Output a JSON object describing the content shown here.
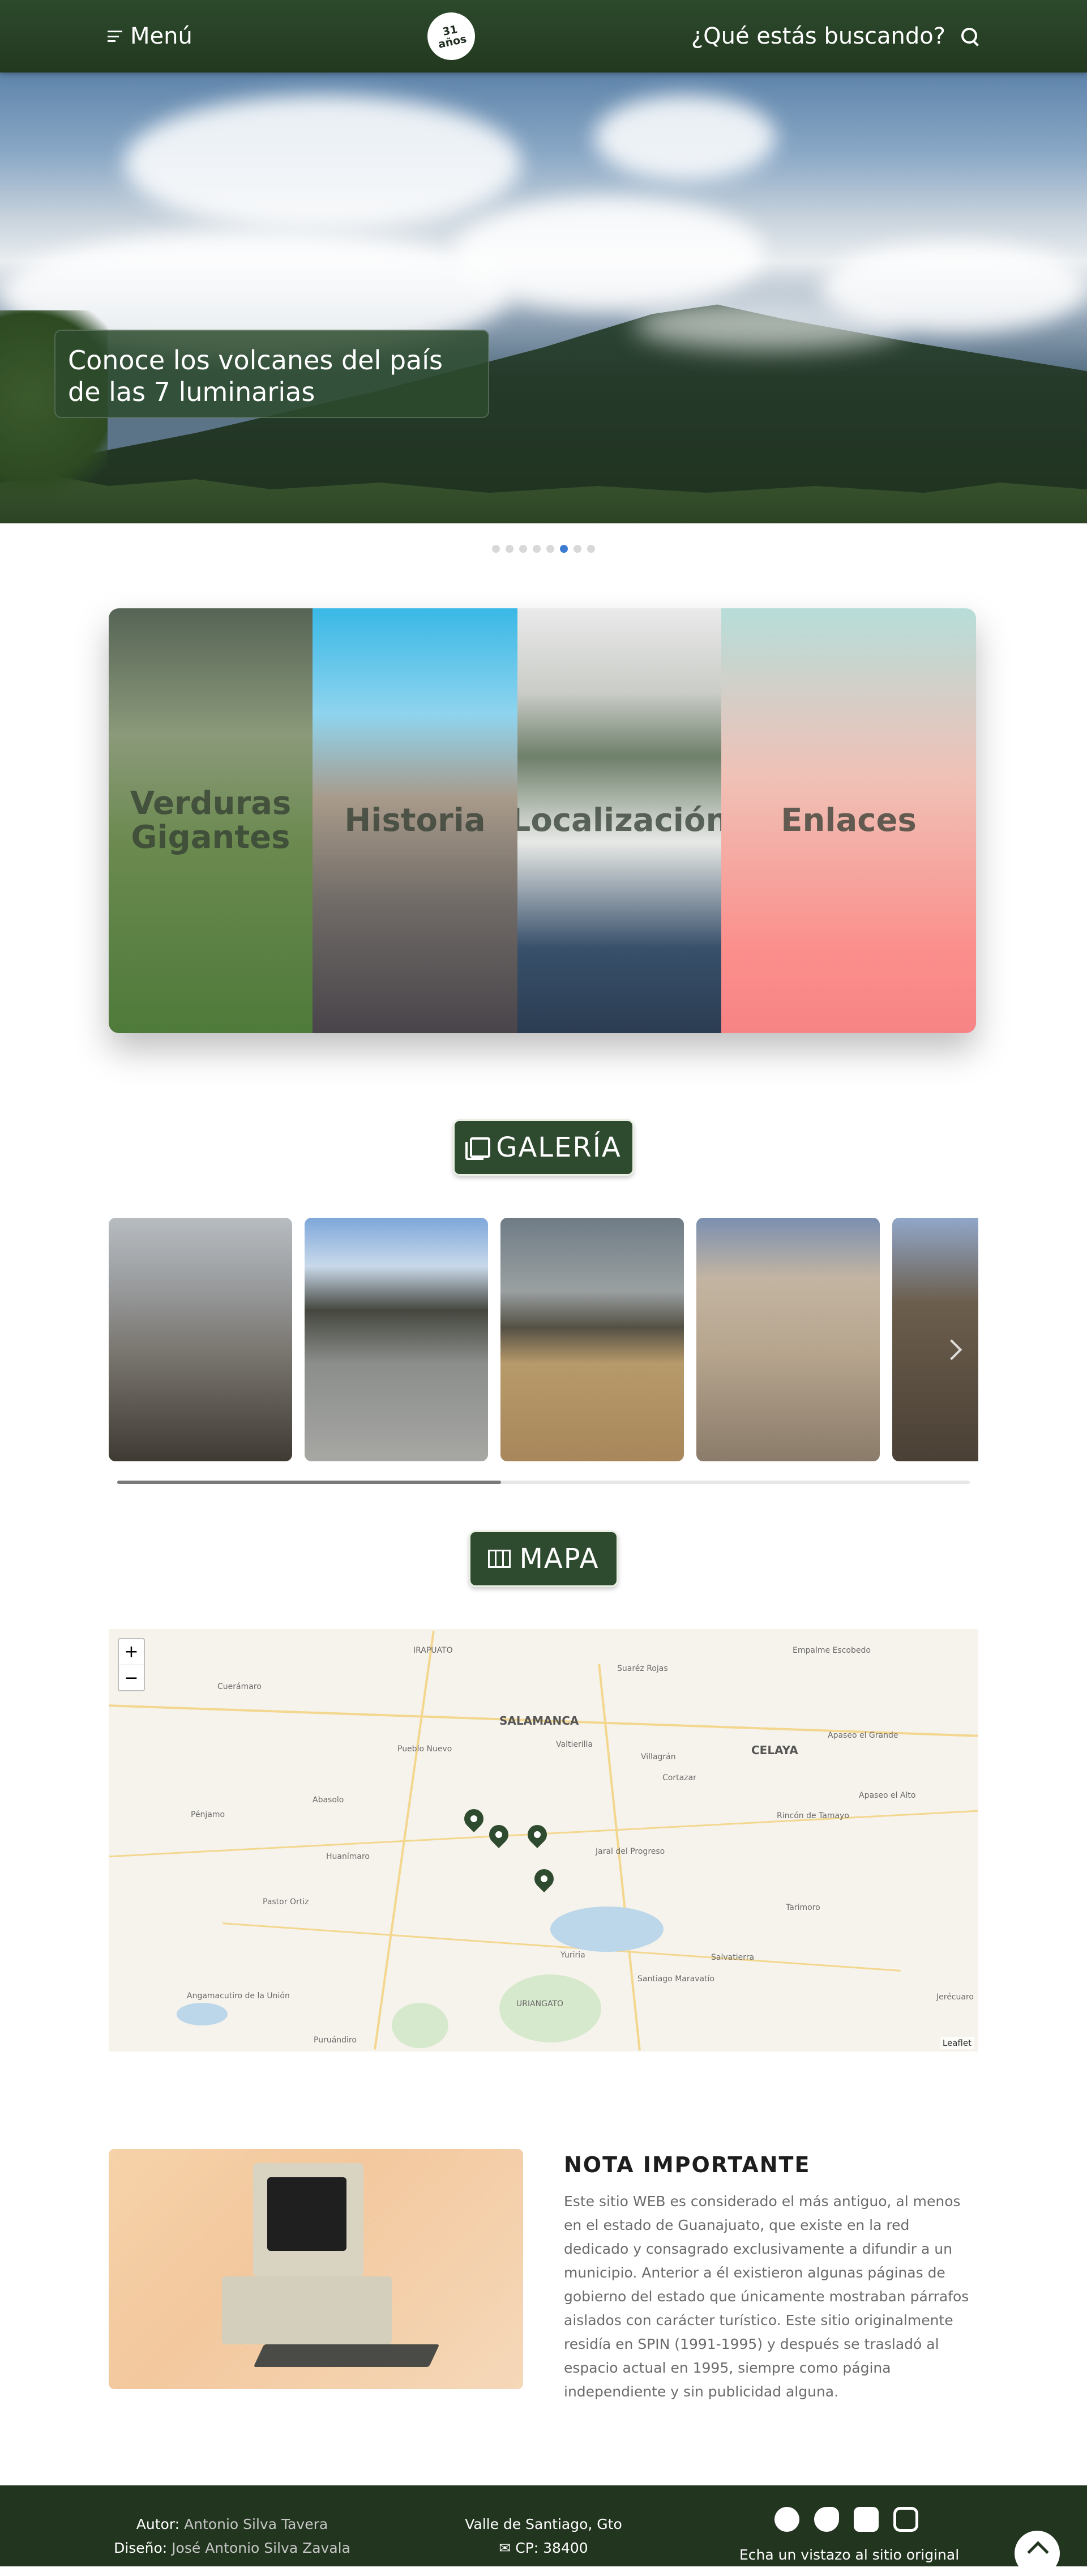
{
  "nav": {
    "menu_label": "Menú",
    "logo_top": "31",
    "logo_bottom": "años",
    "search_label": "¿Qué estás buscando?"
  },
  "hero": {
    "caption": "Conoce los volcanes del país de las 7 luminarias",
    "slide_count": 8,
    "active_slide": 6
  },
  "accordion": {
    "panels": [
      {
        "label": "Verduras Gigantes"
      },
      {
        "label": "Historia"
      },
      {
        "label": "Localización"
      },
      {
        "label": "Enlaces"
      }
    ]
  },
  "gallery": {
    "title": "GALERÍA",
    "scroll_progress": 0.45
  },
  "map": {
    "title": "MAPA",
    "zoom_in": "+",
    "zoom_out": "−",
    "attribution": "Leaflet",
    "cities": [
      "IRAPUATO",
      "Cuerámaro",
      "SALAMANCA",
      "Valtierilla",
      "Villagrán",
      "CELAYA",
      "Apaseo el Grande",
      "Apaseo el Alto",
      "Cortazar",
      "Pueblo Nuevo",
      "Abasolo",
      "Pénjamo",
      "Huanímaro",
      "Jaral del Progreso",
      "Rincón de Tamayo",
      "Tarimoro",
      "Santiago Maravatío",
      "Salvatierra",
      "URIANGATO",
      "Yuriria",
      "Jerécuaro",
      "Pastor Ortiz",
      "Angamacutiro de la Unión",
      "Puruándiro",
      "Suaréz Rojas",
      "Empalme Escobedo"
    ]
  },
  "note": {
    "title": "NOTA IMPORTANTE",
    "text": "Este sitio WEB es considerado el más antiguo, al menos en el estado de Guanajuato, que existe en la red dedicado y consagrado exclusivamente a difundir a un municipio. Anterior a él existieron algunas páginas de gobierno del estado que únicamente mostraban párrafos aislados con carácter turístico. Este sitio originalmente residía en SPIN (1991-1995) y después se trasladó al espacio actual en 1995, siempre como página independiente y sin publicidad alguna."
  },
  "footer": {
    "author_label": "Autor:",
    "author_name": "Antonio Silva Tavera",
    "design_label": "Diseño:",
    "design_name": "José Antonio Silva Zavala",
    "city": "Valle de Santiago, Gto",
    "cp": "CP: 38400",
    "visit_text": "Echa un vistazo al sitio original"
  }
}
